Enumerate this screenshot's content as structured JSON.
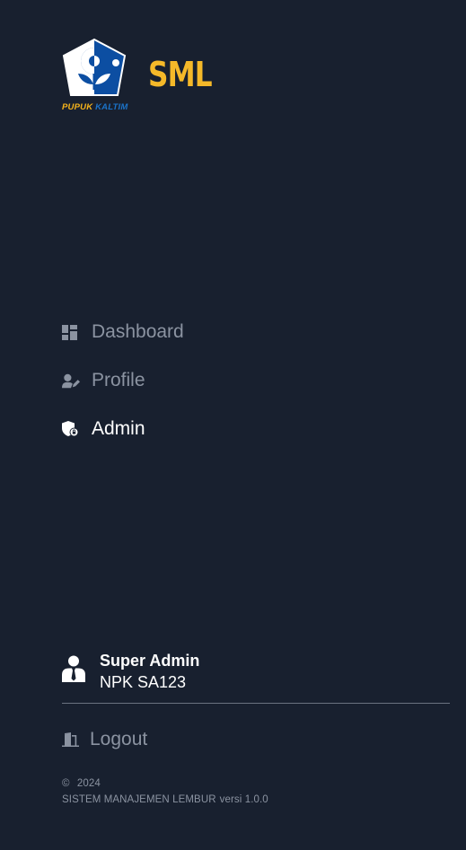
{
  "brand": {
    "logo_word1": "PUPUK",
    "logo_word2": "KALTIM",
    "app_name": "SML",
    "logo_colors": {
      "blue": "#0c4ea2",
      "yellow": "#f7b41b"
    }
  },
  "nav": {
    "items": [
      {
        "label": "Dashboard",
        "icon": "dashboard-icon",
        "active": false
      },
      {
        "label": "Profile",
        "icon": "user-edit-icon",
        "active": false
      },
      {
        "label": "Admin",
        "icon": "shield-lock-icon",
        "active": true
      }
    ]
  },
  "user": {
    "name": "Super Admin",
    "npk": "NPK SA123",
    "icon": "user-tie-icon"
  },
  "logout": {
    "label": "Logout",
    "icon": "door-exit-icon"
  },
  "footer": {
    "copyright_symbol": "©",
    "year": "2024",
    "system_name": "SISTEM MANAJEMEN LEMBUR",
    "version": "versi 1.0.0"
  },
  "colors": {
    "background": "#18202f",
    "accent": "#f5b929",
    "muted_text": "#8b93a1",
    "active_text": "#ffffff"
  }
}
